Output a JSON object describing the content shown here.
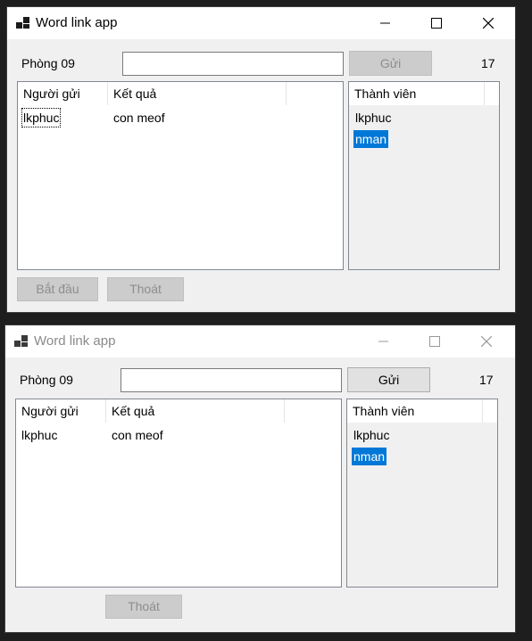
{
  "windows": [
    {
      "title": "Word link app",
      "room_label": "Phòng 09",
      "message_input_value": "",
      "send_label": "Gửi",
      "count": "17",
      "results": {
        "columns": [
          "Người gửi",
          "Kết quả"
        ],
        "rows": [
          {
            "sender": "lkphuc",
            "result": "con meof"
          }
        ]
      },
      "members": {
        "column": "Thành viên",
        "items": [
          "lkphuc",
          "nman"
        ],
        "selected": "nman"
      },
      "start_label": "Bắt đầu",
      "exit_label": "Thoát"
    },
    {
      "title": "Word link app",
      "room_label": "Phòng 09",
      "message_input_value": "",
      "send_label": "Gửi",
      "count": "17",
      "results": {
        "columns": [
          "Người gửi",
          "Kết quả"
        ],
        "rows": [
          {
            "sender": "lkphuc",
            "result": "con meof"
          }
        ]
      },
      "members": {
        "column": "Thành viên",
        "items": [
          "lkphuc",
          "nman"
        ],
        "selected": "nman"
      },
      "exit_label": "Thoát"
    }
  ]
}
